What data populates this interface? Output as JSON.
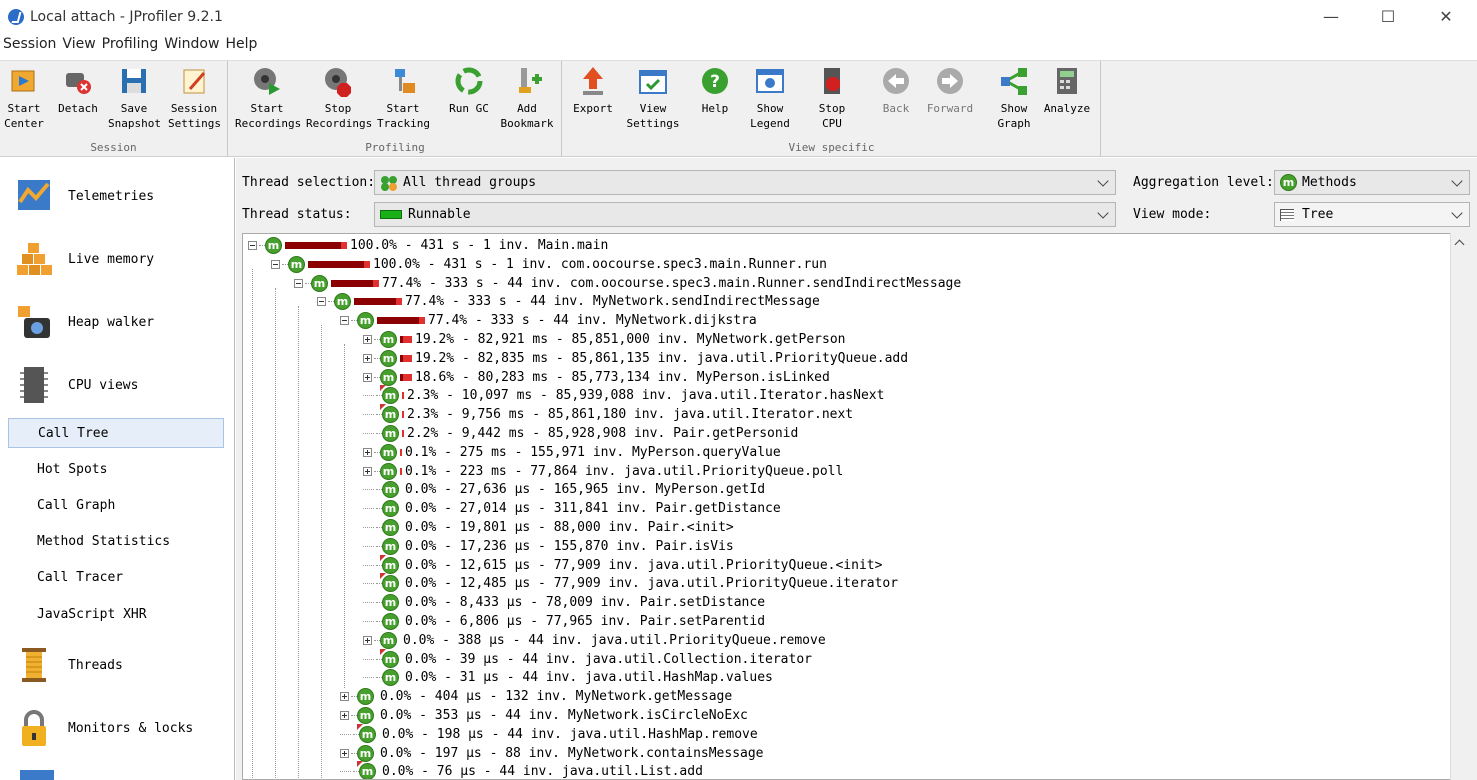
{
  "window": {
    "title": "Local attach - JProfiler 9.2.1",
    "minimize": "—",
    "maximize": "☐",
    "close": "✕"
  },
  "menu": [
    "Session",
    "View",
    "Profiling",
    "Window",
    "Help"
  ],
  "toolbar": {
    "groups": [
      {
        "label": "Session",
        "buttons": [
          "Start\nCenter",
          "Detach",
          "Save\nSnapshot",
          "Session\nSettings"
        ]
      },
      {
        "label": "Profiling",
        "buttons": [
          "Start\nRecordings",
          "Stop\nRecordings",
          "Start\nTracking",
          "Run GC",
          "Add\nBookmark"
        ]
      },
      {
        "label": "View specific",
        "buttons": [
          "Export",
          "View\nSettings",
          "Help",
          "Show\nLegend",
          "Stop\nCPU",
          "Back",
          "Forward",
          "Show\nGraph",
          "Analyze"
        ]
      }
    ]
  },
  "sidebar": {
    "nav": [
      "Telemetries",
      "Live memory",
      "Heap walker",
      "CPU views"
    ],
    "cpu_sub": [
      "Call Tree",
      "Hot Spots",
      "Call Graph",
      "Method Statistics",
      "Call Tracer",
      "JavaScript XHR"
    ],
    "nav2": [
      "Threads",
      "Monitors & locks"
    ],
    "active": "Call Tree"
  },
  "controls": {
    "thread_selection_label": "Thread selection:",
    "thread_selection_value": "All thread groups",
    "thread_status_label": "Thread status:",
    "thread_status_value": "Runnable",
    "aggregation_label": "Aggregation level:",
    "aggregation_value": "Methods",
    "view_mode_label": "View mode:",
    "view_mode_value": "Tree"
  },
  "tree": [
    {
      "text": "100.0% - 431 s - 1 inv. Main.main",
      "pct": 100,
      "depth": 0,
      "exp": "minus"
    },
    {
      "text": "100.0% - 431 s - 1 inv. com.oocourse.spec3.main.Runner.run",
      "pct": 100,
      "depth": 1,
      "exp": "minus"
    },
    {
      "text": "77.4% - 333 s - 44 inv. com.oocourse.spec3.main.Runner.sendIndirectMessage",
      "pct": 77.4,
      "depth": 2,
      "exp": "minus"
    },
    {
      "text": "77.4% - 333 s - 44 inv. MyNetwork.sendIndirectMessage",
      "pct": 77.4,
      "depth": 3,
      "exp": "minus"
    },
    {
      "text": "77.4% - 333 s - 44 inv. MyNetwork.dijkstra",
      "pct": 77.4,
      "depth": 4,
      "exp": "minus"
    },
    {
      "text": "19.2% - 82,921 ms - 85,851,000 inv. MyNetwork.getPerson",
      "pct": 19.2,
      "depth": 5,
      "exp": "plus"
    },
    {
      "text": "19.2% - 82,835 ms - 85,861,135 inv. java.util.PriorityQueue.add",
      "pct": 19.2,
      "depth": 5,
      "exp": "plus"
    },
    {
      "text": "18.6% - 80,283 ms - 85,773,134 inv. MyPerson.isLinked",
      "pct": 18.6,
      "depth": 5,
      "exp": "plus"
    },
    {
      "text": "2.3% - 10,097 ms - 85,939,088 inv. java.util.Iterator.hasNext",
      "pct": 2.3,
      "depth": 5,
      "exp": "none",
      "tri": true
    },
    {
      "text": "2.3% - 9,756 ms - 85,861,180 inv. java.util.Iterator.next",
      "pct": 2.3,
      "depth": 5,
      "exp": "none",
      "tri": true
    },
    {
      "text": "2.2% - 9,442 ms - 85,928,908 inv. Pair.getPersonid",
      "pct": 2.2,
      "depth": 5,
      "exp": "none"
    },
    {
      "text": "0.1% - 275 ms - 155,971 inv. MyPerson.queryValue",
      "pct": 0.1,
      "depth": 5,
      "exp": "plus"
    },
    {
      "text": "0.1% - 223 ms - 77,864 inv. java.util.PriorityQueue.poll",
      "pct": 0.1,
      "depth": 5,
      "exp": "plus"
    },
    {
      "text": "0.0% - 27,636 µs - 165,965 inv. MyPerson.getId",
      "pct": 0,
      "depth": 5,
      "exp": "none"
    },
    {
      "text": "0.0% - 27,014 µs - 311,841 inv. Pair.getDistance",
      "pct": 0,
      "depth": 5,
      "exp": "none"
    },
    {
      "text": "0.0% - 19,801 µs - 88,000 inv. Pair.<init>",
      "pct": 0,
      "depth": 5,
      "exp": "none"
    },
    {
      "text": "0.0% - 17,236 µs - 155,870 inv. Pair.isVis",
      "pct": 0,
      "depth": 5,
      "exp": "none"
    },
    {
      "text": "0.0% - 12,615 µs - 77,909 inv. java.util.PriorityQueue.<init>",
      "pct": 0,
      "depth": 5,
      "exp": "none",
      "tri": true
    },
    {
      "text": "0.0% - 12,485 µs - 77,909 inv. java.util.PriorityQueue.iterator",
      "pct": 0,
      "depth": 5,
      "exp": "none",
      "tri": true
    },
    {
      "text": "0.0% - 8,433 µs - 78,009 inv. Pair.setDistance",
      "pct": 0,
      "depth": 5,
      "exp": "none"
    },
    {
      "text": "0.0% - 6,806 µs - 77,965 inv. Pair.setParentid",
      "pct": 0,
      "depth": 5,
      "exp": "none"
    },
    {
      "text": "0.0% - 388 µs - 44 inv. java.util.PriorityQueue.remove",
      "pct": 0,
      "depth": 5,
      "exp": "plus"
    },
    {
      "text": "0.0% - 39 µs - 44 inv. java.util.Collection.iterator",
      "pct": 0,
      "depth": 5,
      "exp": "none",
      "tri": true
    },
    {
      "text": "0.0% - 31 µs - 44 inv. java.util.HashMap.values",
      "pct": 0,
      "depth": 5,
      "exp": "none"
    },
    {
      "text": "0.0% - 404 µs - 132 inv. MyNetwork.getMessage",
      "pct": 0,
      "depth": 4,
      "exp": "plus"
    },
    {
      "text": "0.0% - 353 µs - 44 inv. MyNetwork.isCircleNoExc",
      "pct": 0,
      "depth": 4,
      "exp": "plus"
    },
    {
      "text": "0.0% - 198 µs - 44 inv. java.util.HashMap.remove",
      "pct": 0,
      "depth": 4,
      "exp": "none",
      "tri": true
    },
    {
      "text": "0.0% - 197 µs - 88 inv. MyNetwork.containsMessage",
      "pct": 0,
      "depth": 4,
      "exp": "plus"
    },
    {
      "text": "0.0% - 76 µs - 44 inv. java.util.List.add",
      "pct": 0,
      "depth": 4,
      "exp": "none",
      "tri": true
    }
  ]
}
